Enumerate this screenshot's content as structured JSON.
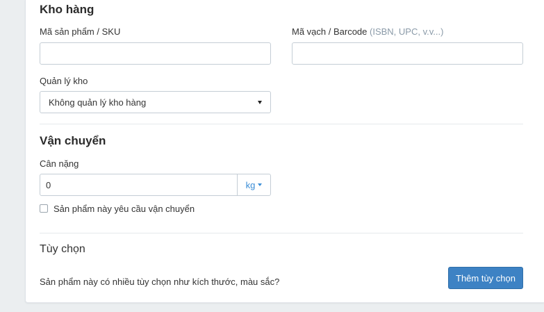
{
  "inventory": {
    "title": "Kho hàng",
    "sku_label": "Mã sản phẩm / SKU",
    "sku_value": "",
    "barcode_label": "Mã vạch / Barcode",
    "barcode_hint": "(ISBN, UPC, v.v...)",
    "barcode_value": "",
    "manage_label": "Quản lý kho",
    "manage_selected": "Không quản lý kho hàng"
  },
  "shipping": {
    "title": "Vận chuyển",
    "weight_label": "Cân nặng",
    "weight_value": "0",
    "weight_unit": "kg",
    "requires_shipping_label": "Sản phẩm này yêu cầu vận chuyển",
    "requires_shipping_checked": false
  },
  "options": {
    "title": "Tùy chọn",
    "question": "Sản phẩm này có nhiều tùy chọn như kích thước, màu sắc?",
    "add_button": "Thêm tùy chọn"
  },
  "colors": {
    "primary": "#3d82c4",
    "link": "#3a8dd6",
    "background": "#ebeef0"
  }
}
